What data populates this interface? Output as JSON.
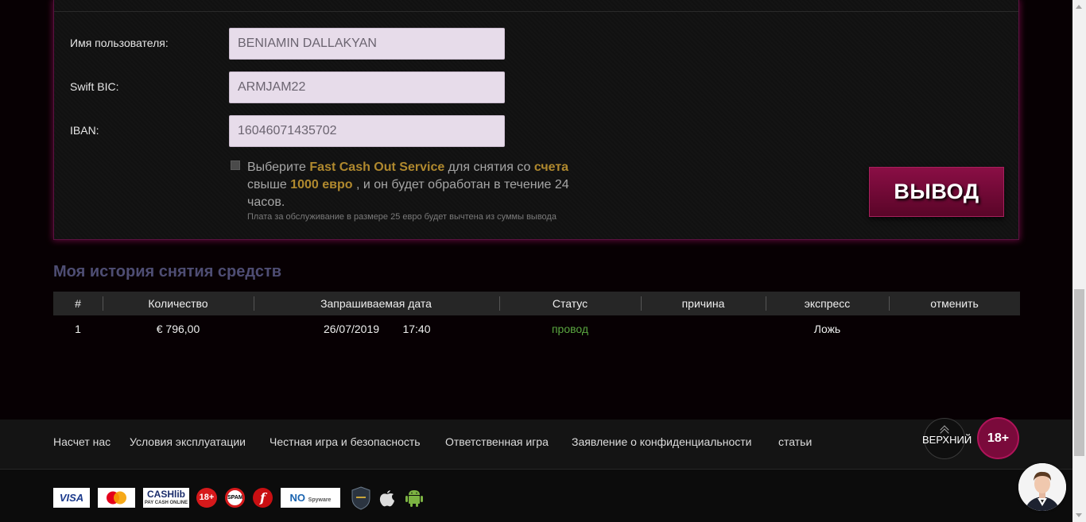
{
  "form": {
    "username_label": "Имя пользователя:",
    "username_value": "BENIAMIN DALLAKYAN",
    "swift_label": "Swift BIC:",
    "swift_value": "ARMJAM22",
    "iban_label": "IBAN:",
    "iban_value": "16046071435702",
    "fast_cashout": {
      "part1": "Выберите ",
      "hl1": "Fast Cash Out Service",
      "part2": " для снятия со ",
      "hl2": "счета",
      "part3": " свыше ",
      "hl3": "1000 евро",
      "part4": " , и он будет обработан в течение 24 часов.",
      "fee_note": "Плата за обслуживание в размере 25 евро будет вычтена из суммы вывода"
    },
    "withdraw_label": "ВЫВОД"
  },
  "history": {
    "title": "Моя история снятия средств",
    "columns": [
      "#",
      "Количество",
      "Запрашиваемая дата",
      "Статус",
      "причина",
      "экспресс",
      "отменить"
    ],
    "rows": [
      {
        "num": "1",
        "amount": "€ 796,00",
        "date": "26/07/2019",
        "time": "17:40",
        "status": "провод",
        "reason": "",
        "express": "Ложь",
        "cancel": ""
      }
    ]
  },
  "footer": {
    "links": [
      "Насчет нас",
      "Условия эксплуатации",
      "Честная игра и безопасность",
      "Ответственная игра",
      "Заявление о конфиденциальности",
      "статьи"
    ],
    "top_label": "ВЕРХНИЙ",
    "age_label": "18+",
    "logos": {
      "visa": "VISA",
      "cashlib": "CASHlib",
      "cashlib_sub": "PAY CASH ONLINE",
      "age": "18+",
      "spam": "SPAM",
      "flash": "f",
      "nospy": "NO",
      "nospy_sub": "Spyware Adware"
    }
  },
  "colors": {
    "accent": "#7a0a3b",
    "highlight": "#b0892e",
    "status_ok": "#5aa640",
    "title": "#4e4d73",
    "input_bg": "#e7dcea"
  }
}
